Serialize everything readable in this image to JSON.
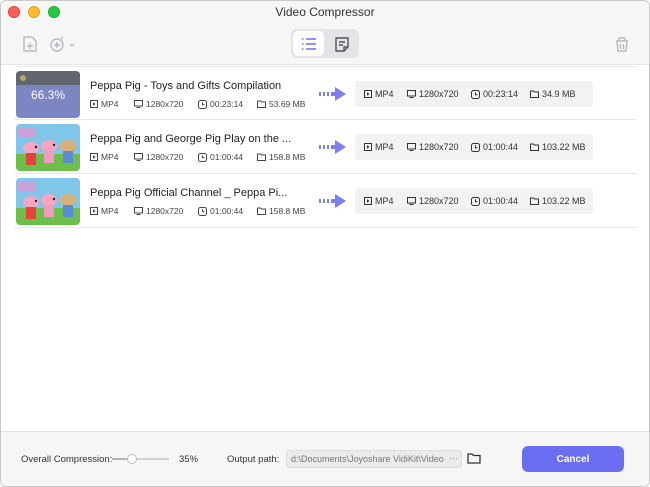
{
  "window": {
    "title": "Video Compressor"
  },
  "toolbar": {
    "add_file_icon": "add-file-icon",
    "add_more_icon": "add-more-icon",
    "list_view_icon": "list-view-icon",
    "detail_view_icon": "detail-view-icon",
    "trash_icon": "trash-icon"
  },
  "videos": [
    {
      "name": "Peppa Pig - Toys and Gifts Compilation",
      "progress_label": "66.3%",
      "progress": 0.663,
      "source": {
        "format": "MP4",
        "resolution": "1280x720",
        "duration": "00:23:14",
        "size": "53.69 MB"
      },
      "output": {
        "format": "MP4",
        "resolution": "1280x720",
        "duration": "00:23:14",
        "size": "34.9 MB"
      }
    },
    {
      "name": "Peppa Pig and George Pig Play on the ...",
      "source": {
        "format": "MP4",
        "resolution": "1280x720",
        "duration": "01:00:44",
        "size": "158.8 MB"
      },
      "output": {
        "format": "MP4",
        "resolution": "1280x720",
        "duration": "01:00:44",
        "size": "103.22 MB"
      }
    },
    {
      "name": "Peppa Pig Official Channel _ Peppa Pi...",
      "source": {
        "format": "MP4",
        "resolution": "1280x720",
        "duration": "01:00:44",
        "size": "158.8 MB"
      },
      "output": {
        "format": "MP4",
        "resolution": "1280x720",
        "duration": "01:00:44",
        "size": "103.22 MB"
      }
    }
  ],
  "footer": {
    "compression_label": "Overall Compression:",
    "compression_value": "35%",
    "compression_fraction": 0.35,
    "output_path_label": "Output path:",
    "output_path": "d:\\Documents\\Joyoshare VidiKit\\Video",
    "path_more": "···",
    "cancel_label": "Cancel"
  },
  "colors": {
    "accent": "#6c6ef2",
    "arrow": "#7b7ff2"
  }
}
